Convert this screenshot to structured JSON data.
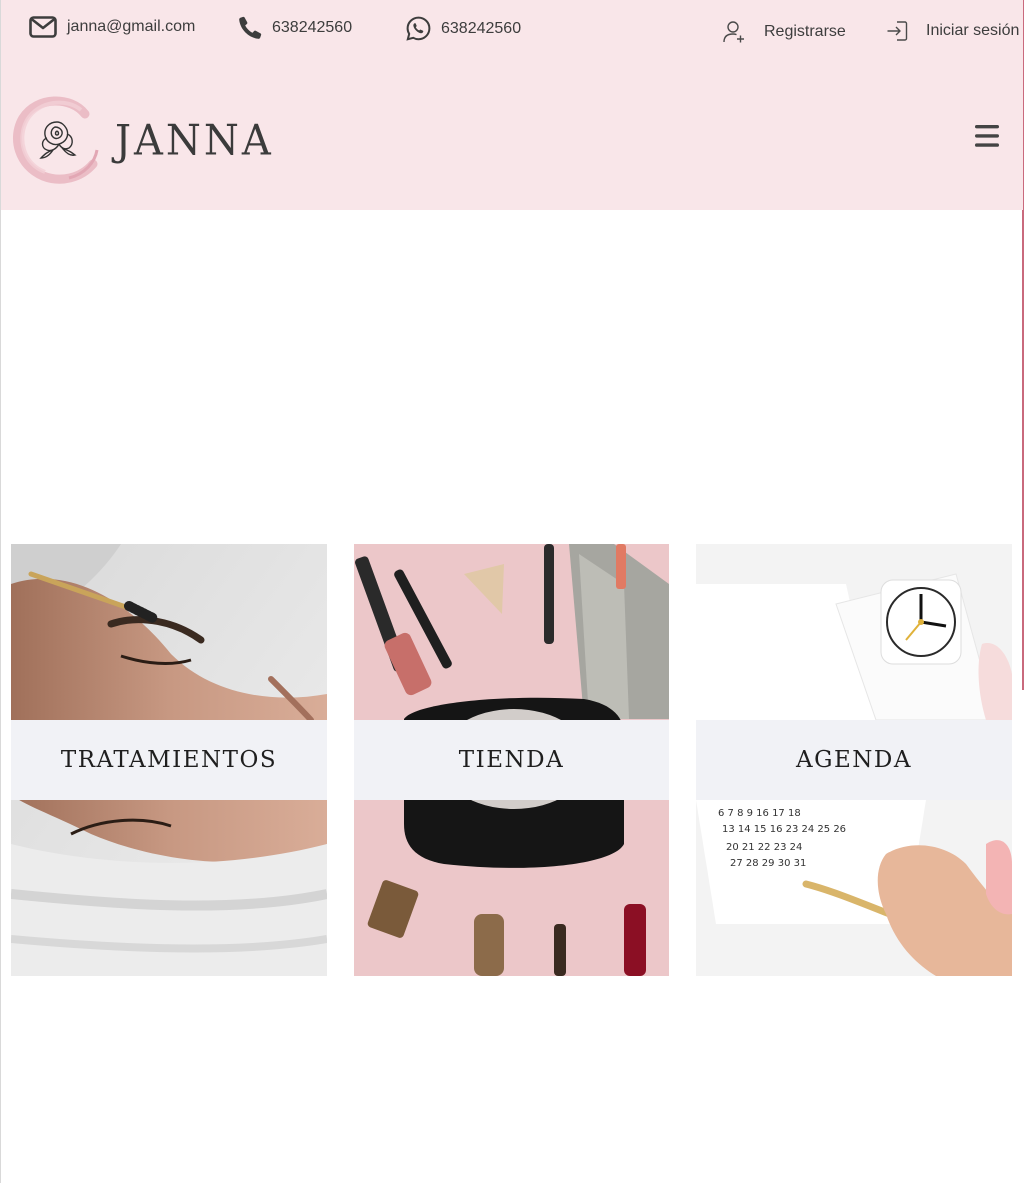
{
  "topbar": {
    "email": "janna@gmail.com",
    "phone": "638242560",
    "whatsapp": "638242560",
    "register_label": "Registrarse",
    "login_label": "Iniciar sesión"
  },
  "brand": {
    "name": "JANNA"
  },
  "cards": [
    {
      "label": "TRATAMIENTOS",
      "image": "eyebrow-treatment-photo"
    },
    {
      "label": "TIENDA",
      "image": "makeup-products-photo"
    },
    {
      "label": "AGENDA",
      "image": "calendar-clock-photo"
    }
  ],
  "colors": {
    "header_bg": "#f9e6e9",
    "card_label_bg": "#f1f2f6",
    "accent": "#c96a7d",
    "text": "#3d3d3d"
  }
}
